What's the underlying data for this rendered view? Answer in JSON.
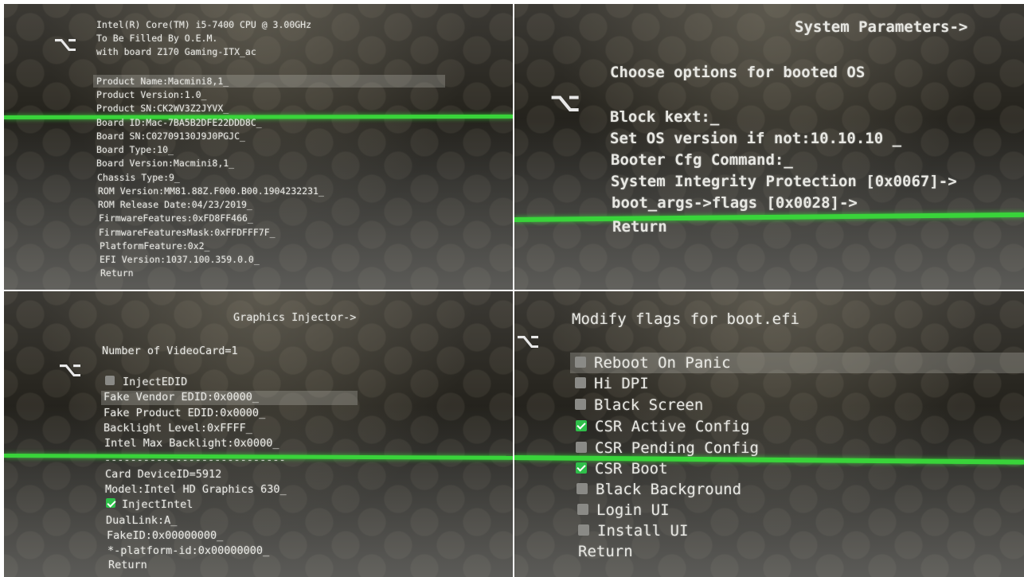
{
  "colors": {
    "selection_bar": "#39d43a",
    "text": "#e7e7e2",
    "checkbox_on": "#2fbf4a",
    "checkbox_off": "#8a8a86"
  },
  "glyph": "⌥",
  "panel1": {
    "header": [
      "Intel(R) Core(TM) i5-7400 CPU @ 3.00GHz",
      "To Be Filled By O.E.M.",
      "with board Z170 Gaming-ITX_ac"
    ],
    "items": [
      "Product Name:Macmini8,1_",
      "Product Version:1.0_",
      "Product SN:CK2WV3Z2JYVX_",
      "Board ID:Mac-7BA5B2DFE22DDD8C_",
      "Board SN:C02709130J9J0PGJC_",
      "Board Type:10_",
      "Board Version:Macmini8,1_",
      "Chassis Type:9_",
      "ROM Version:MM81.88Z.F000.B00.1904232231_",
      "ROM Release Date:04/23/2019_",
      "FirmwareFeatures:0xFD8FF466_",
      "FirmwareFeaturesMask:0xFFDFFF7F_",
      "PlatformFeature:0x2_",
      "EFI Version:1037.100.359.0.0_",
      "Return"
    ]
  },
  "panel2": {
    "title": "System Parameters->",
    "heading": "Choose options for booted OS",
    "items": [
      "Block kext:_",
      "Set OS version if not:10.10.10 _",
      "Booter Cfg Command:_",
      "System Integrity Protection [0x0067]->",
      "boot_args->flags [0x0028]->",
      "Return"
    ]
  },
  "panel3": {
    "title": "Graphics Injector->",
    "count": "Number of VideoCard=1",
    "inject_edid": {
      "label": "InjectEDID",
      "checked": false
    },
    "items": [
      "Fake Vendor EDID:0x0000_",
      "Fake Product EDID:0x0000_",
      "Backlight Level:0xFFFF_",
      "Intel Max Backlight:0x0000_"
    ],
    "separator": "----------------------------",
    "card_items": [
      "Card DeviceID=5912",
      "Model:Intel HD Graphics 630_"
    ],
    "inject_intel": {
      "label": "InjectIntel",
      "checked": true
    },
    "more_items": [
      "DualLink:A_",
      "FakeID:0x00000000_",
      "*-platform-id:0x00000000_",
      "Return"
    ]
  },
  "panel4": {
    "title": "Modify flags for boot.efi",
    "flags": [
      {
        "label": "Reboot On Panic",
        "checked": false
      },
      {
        "label": "Hi DPI",
        "checked": false
      },
      {
        "label": "Black Screen",
        "checked": false
      },
      {
        "label": "CSR Active Config",
        "checked": true
      },
      {
        "label": "CSR Pending Config",
        "checked": false
      },
      {
        "label": "CSR Boot",
        "checked": true
      },
      {
        "label": "Black Background",
        "checked": false
      },
      {
        "label": "Login UI",
        "checked": false
      },
      {
        "label": "Install UI",
        "checked": false
      }
    ],
    "return_label": "Return"
  }
}
